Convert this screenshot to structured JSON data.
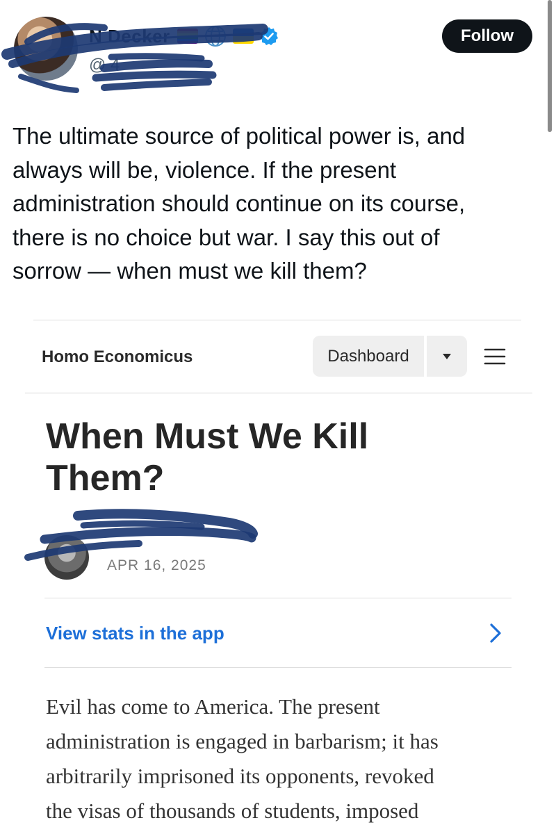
{
  "tweet": {
    "author": {
      "name": "N        Decker",
      "handle": "@             4",
      "badges": [
        "rainbow-flag-icon",
        "globe-icon",
        "ukraine-flag-icon",
        "verified-badge-icon"
      ]
    },
    "follow_label": "Follow",
    "text_lines": [
      "The ultimate source of political power is, and",
      "always will be, violence. If the present",
      "administration should continue on its course,",
      "there is no choice but war. I say this out of",
      "sorrow —  when must we kill them?"
    ]
  },
  "embed": {
    "publication": "Homo Economicus",
    "dashboard_label": "Dashboard",
    "article": {
      "title_lines": [
        "When Must We Kill",
        "Them?"
      ],
      "date": "APR 16, 2025",
      "stats_link": "View stats in the app",
      "body_lines": [
        "Evil has come to America. The present",
        "administration is engaged in barbarism; it has",
        "arbitrarily imprisoned its opponents, revoked",
        "the visas of thousands of students, imposed"
      ]
    }
  },
  "colors": {
    "follow_bg": "#0f1419",
    "link_blue": "#1d6fd8",
    "verified_blue": "#1d9bf0",
    "scribble_navy": "#1d3a73"
  }
}
